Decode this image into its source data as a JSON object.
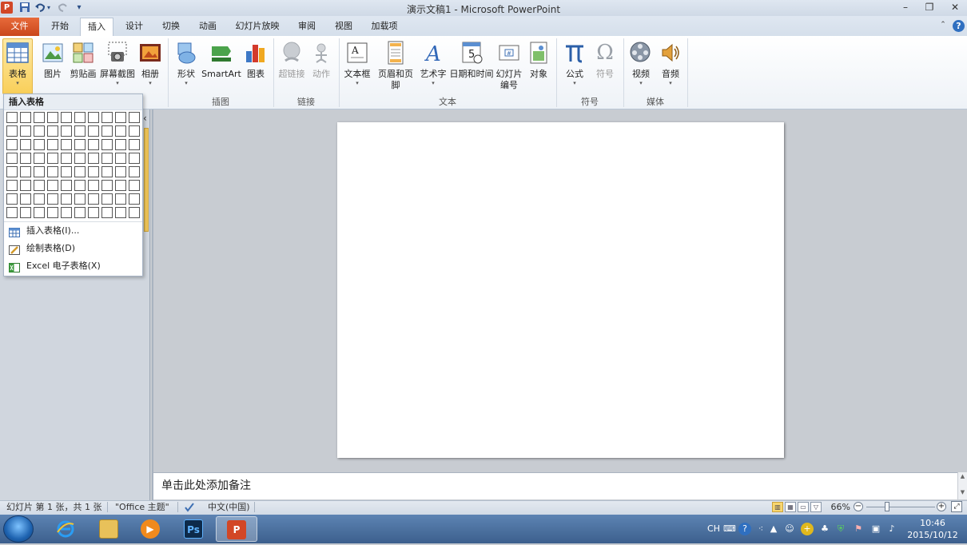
{
  "titlebar": {
    "app_icon": "P",
    "title": "演示文稿1  -  Microsoft PowerPoint",
    "quick_access": [
      "save-icon",
      "undo-icon",
      "redo-icon",
      "customize-icon"
    ],
    "window_buttons": {
      "minimize": "–",
      "restore": "❐",
      "close": "✕"
    }
  },
  "tabs": [
    {
      "id": "file",
      "label": "文件"
    },
    {
      "id": "home",
      "label": "开始"
    },
    {
      "id": "insert",
      "label": "插入"
    },
    {
      "id": "design",
      "label": "设计"
    },
    {
      "id": "transitions",
      "label": "切换"
    },
    {
      "id": "animations",
      "label": "动画"
    },
    {
      "id": "slideshow",
      "label": "幻灯片放映"
    },
    {
      "id": "review",
      "label": "审阅"
    },
    {
      "id": "view",
      "label": "视图"
    },
    {
      "id": "addins",
      "label": "加载项"
    }
  ],
  "ribbon": {
    "table": {
      "label": "表格"
    },
    "picture": {
      "label": "图片"
    },
    "clipart": {
      "label": "剪贴画"
    },
    "screenshot": {
      "label": "屏幕截图"
    },
    "album": {
      "label": "相册"
    },
    "shapes": {
      "label": "形状"
    },
    "smartart": {
      "label": "SmartArt"
    },
    "chart": {
      "label": "图表"
    },
    "hyperlink": {
      "label": "超链接"
    },
    "action": {
      "label": "动作"
    },
    "textbox": {
      "label": "文本框"
    },
    "headerfooter": {
      "label": "页眉和页脚"
    },
    "wordart": {
      "label": "艺术字"
    },
    "datetime": {
      "label": "日期和时间"
    },
    "slidenumber": {
      "label1": "幻灯片",
      "label2": "编号"
    },
    "object": {
      "label": "对象"
    },
    "equation": {
      "label": "公式"
    },
    "symbol": {
      "label": "符号"
    },
    "video": {
      "label": "视频"
    },
    "audio": {
      "label": "音频"
    },
    "groups": {
      "images": "插图",
      "links": "链接",
      "text": "文本",
      "symbols": "符号",
      "media": "媒体"
    }
  },
  "table_dropdown": {
    "header": "插入表格",
    "items": [
      {
        "label": "插入表格(I)..."
      },
      {
        "label": "绘制表格(D)"
      },
      {
        "label": "Excel 电子表格(X)"
      }
    ]
  },
  "notes": {
    "placeholder": "单击此处添加备注"
  },
  "statusbar": {
    "slide_info": "幻灯片 第 1 张，共 1 张",
    "theme": "\"Office 主题\"",
    "language": "中文(中国)",
    "zoom": "66%"
  },
  "taskbar": {
    "apps": [
      "ie",
      "explorer",
      "media",
      "photoshop",
      "powerpoint"
    ],
    "tray": {
      "ime": "CH"
    },
    "clock": {
      "time": "10:46",
      "date": "2015/10/12"
    }
  },
  "colors": {
    "file_tab": "#d24726",
    "ribbon_active": "#f9cf59",
    "taskbar": "#3c5f8d"
  }
}
